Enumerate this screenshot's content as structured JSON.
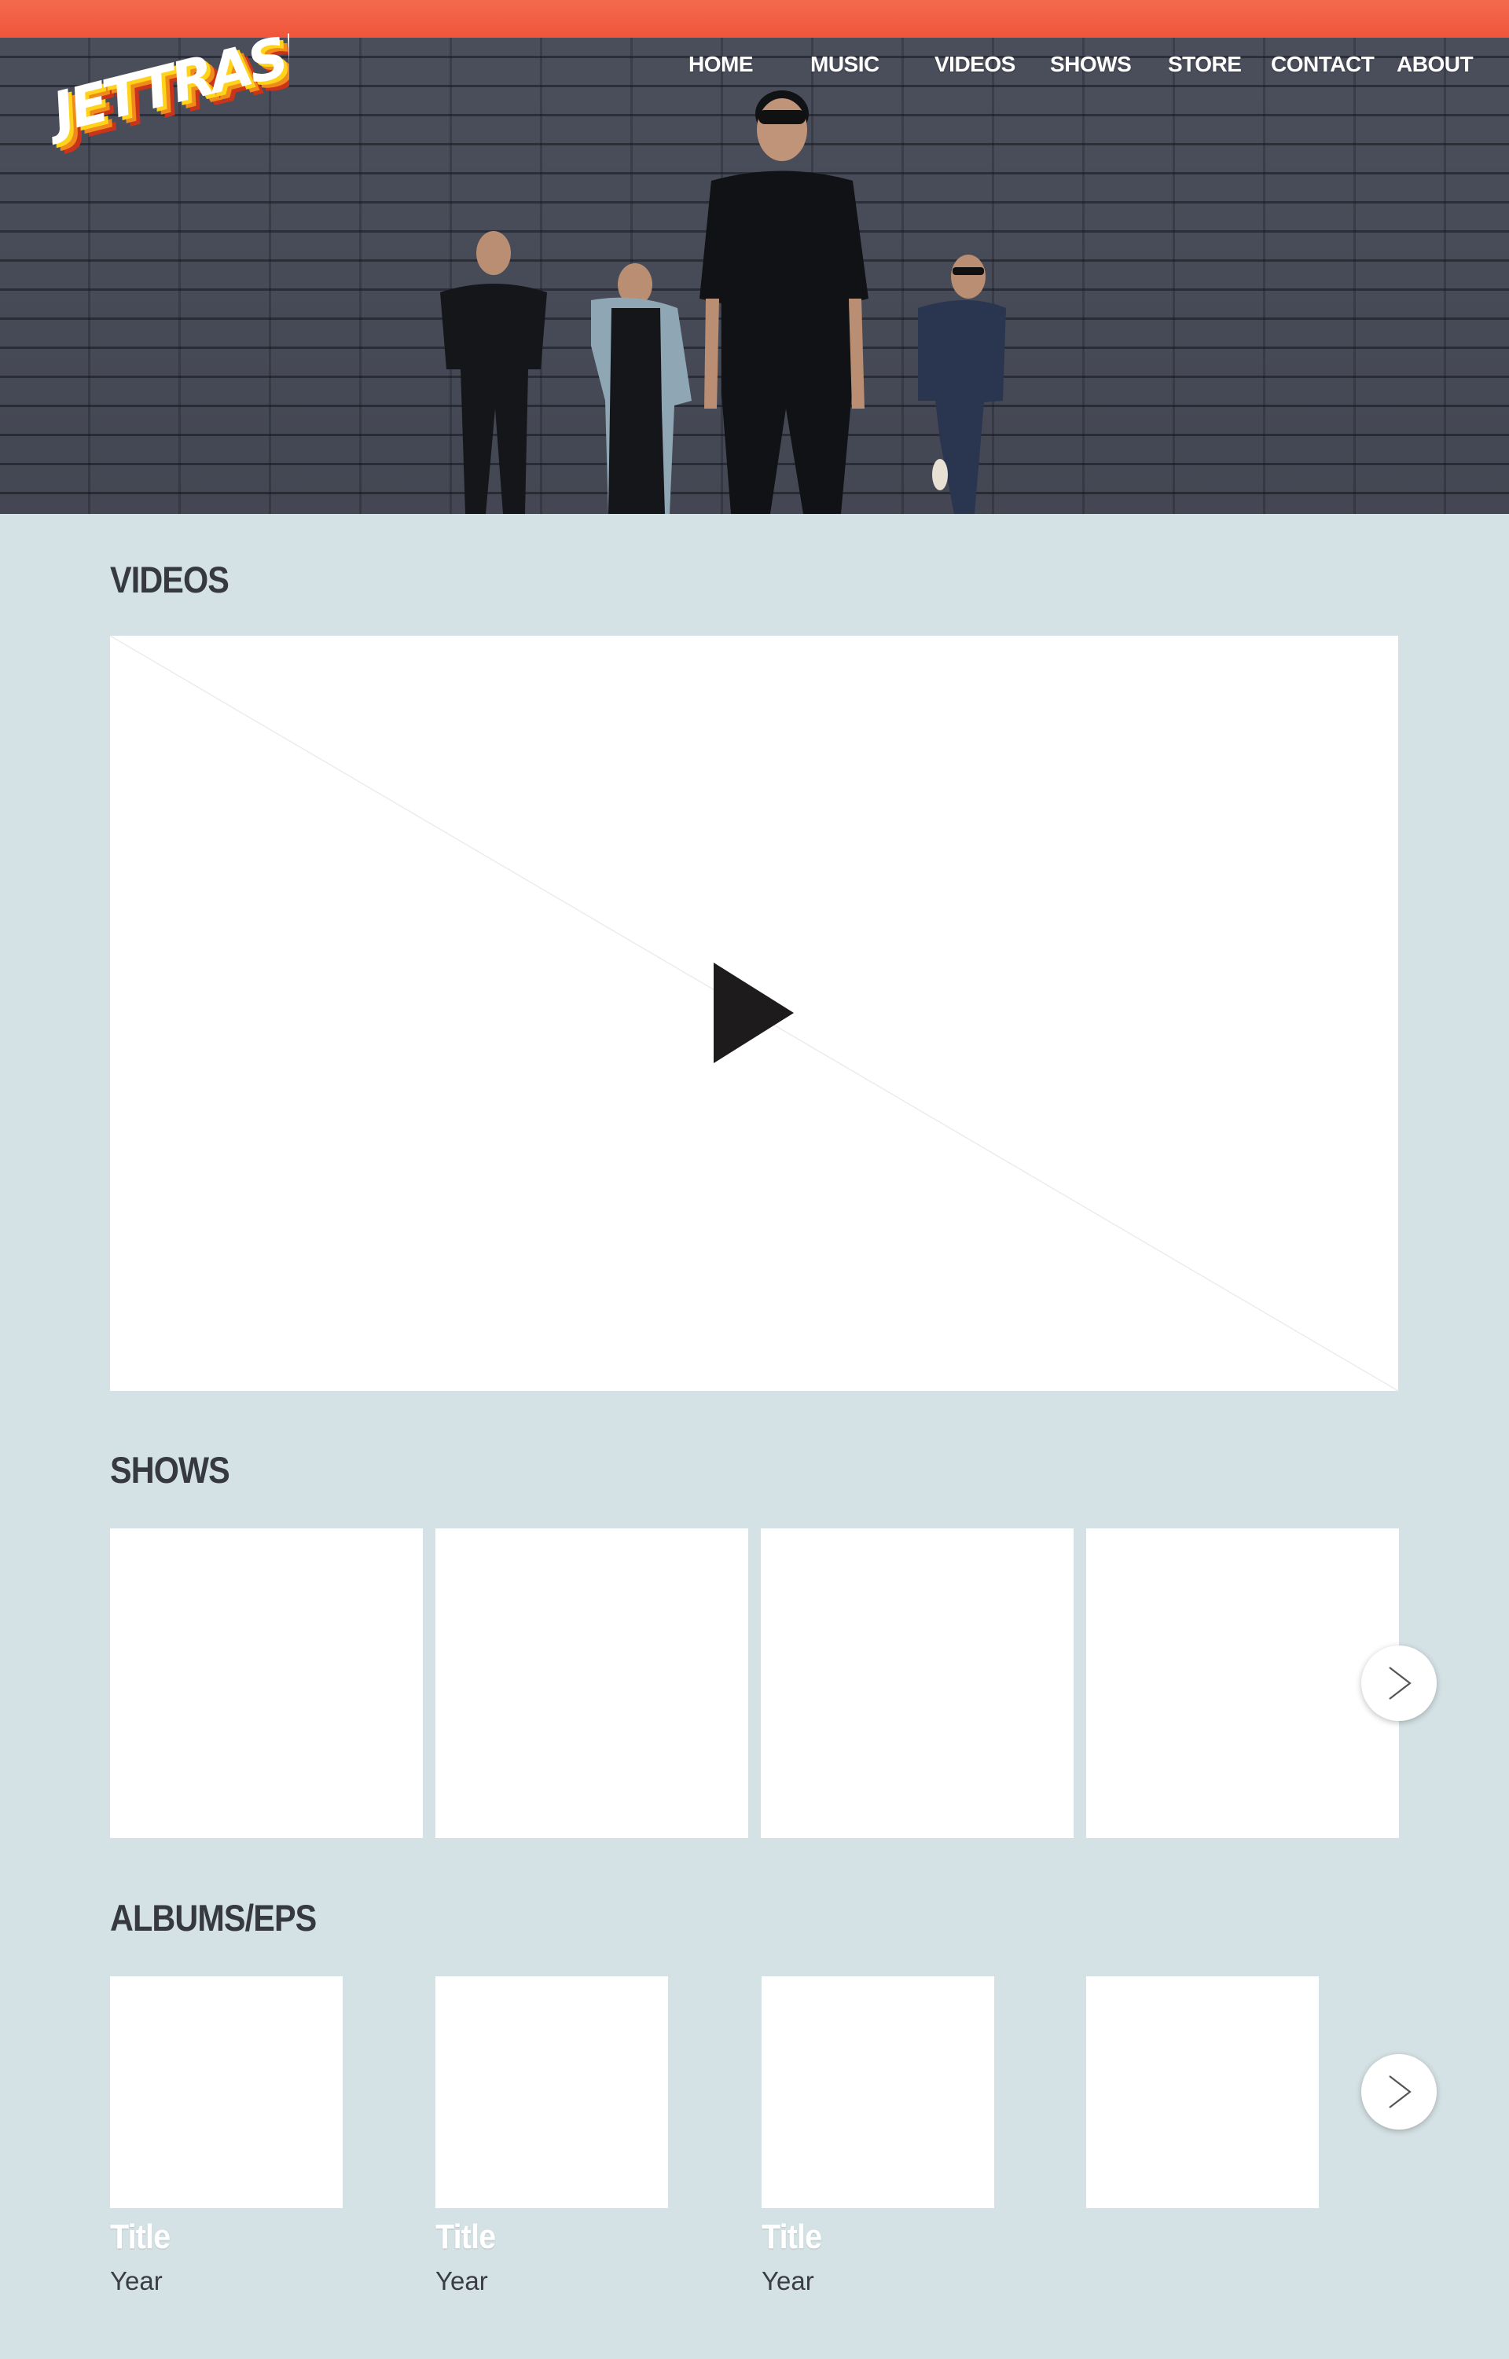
{
  "brand": {
    "logo_text": "JETTRASH",
    "accent_color": "#f0553b",
    "background_color": "#d5e2e5"
  },
  "nav": {
    "items": [
      {
        "label": "HOME"
      },
      {
        "label": "MUSIC"
      },
      {
        "label": "VIDEOS"
      },
      {
        "label": "SHOWS"
      },
      {
        "label": "STORE"
      },
      {
        "label": "CONTACT"
      },
      {
        "label": "ABOUT"
      }
    ]
  },
  "videos": {
    "heading": "VIDEOS",
    "play_icon": "play-icon"
  },
  "shows": {
    "heading": "SHOWS",
    "next_icon": "chevron-right-icon"
  },
  "albums": {
    "heading": "ALBUMS/EPS",
    "next_icon": "chevron-right-icon",
    "items": [
      {
        "title": "Title",
        "year": "Year"
      },
      {
        "title": "Title",
        "year": "Year"
      },
      {
        "title": "Title",
        "year": "Year"
      },
      {
        "title": "",
        "year": ""
      }
    ]
  }
}
